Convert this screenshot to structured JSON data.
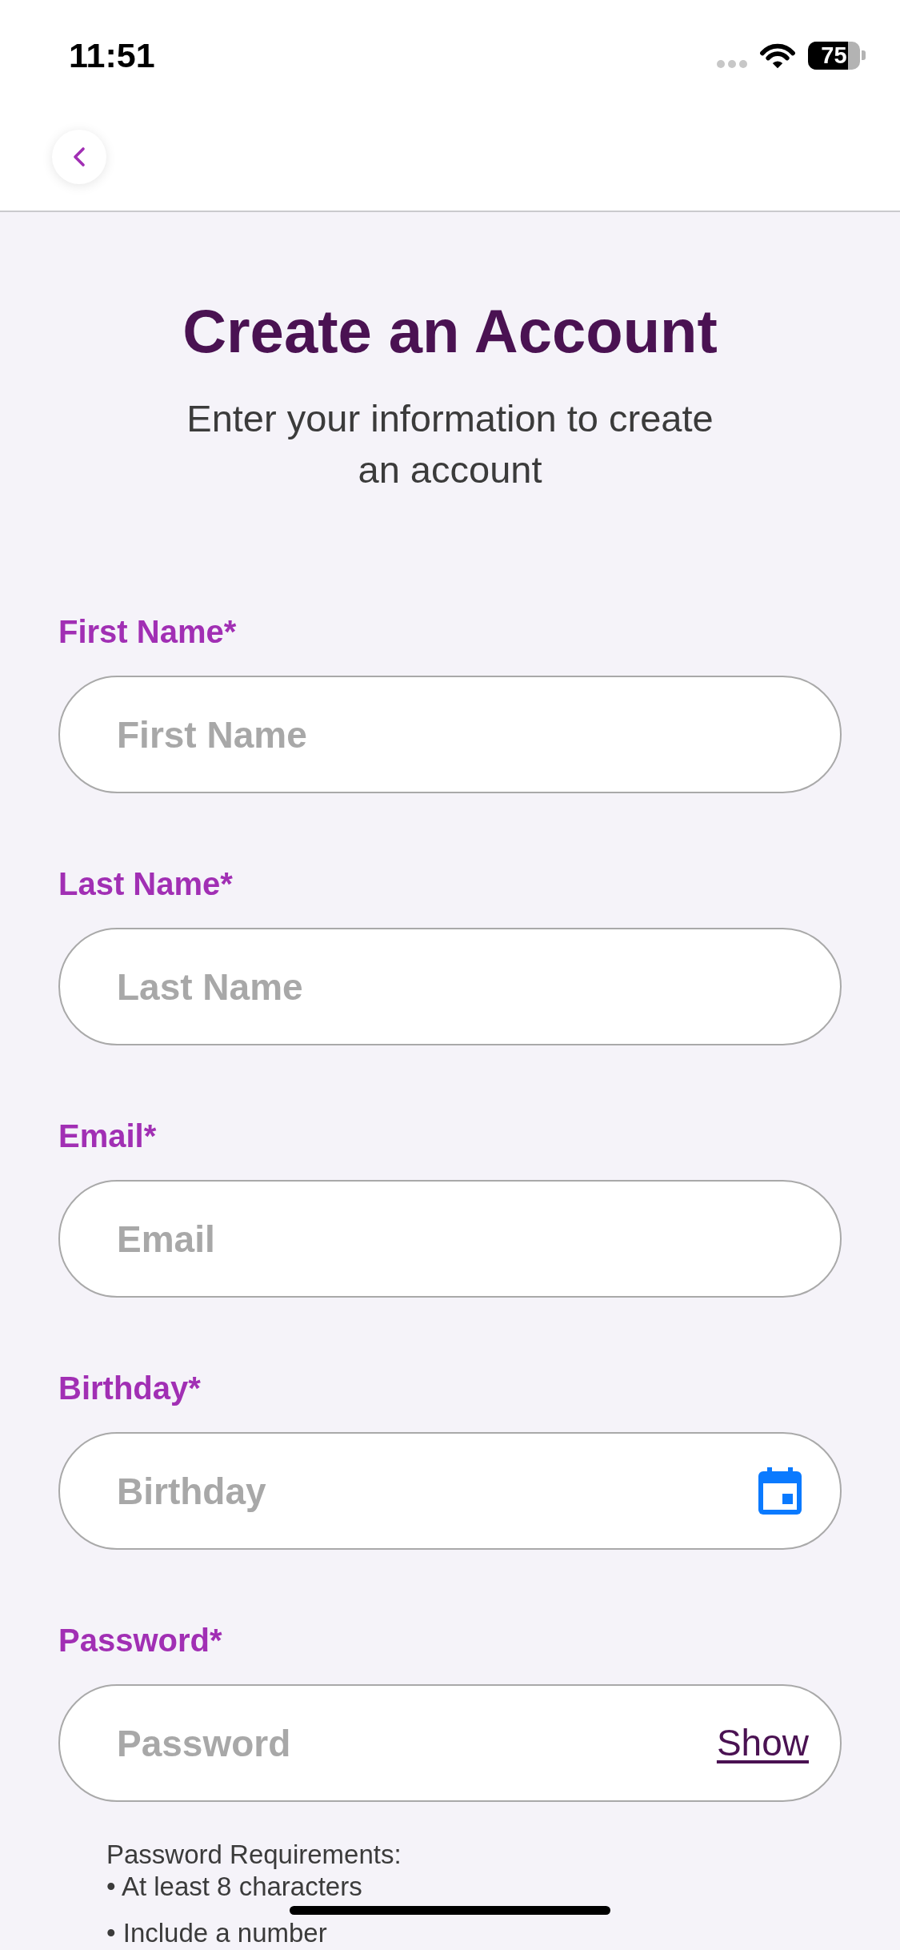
{
  "status_bar": {
    "time": "11:51",
    "battery": "75"
  },
  "title": "Create an Account",
  "subtitle": "Enter your information to create an account",
  "fields": [
    {
      "label": "First Name*",
      "placeholder": "First Name",
      "kind": "text"
    },
    {
      "label": "Last Name*",
      "placeholder": "Last Name",
      "kind": "text"
    },
    {
      "label": "Email*",
      "placeholder": "Email",
      "kind": "text"
    },
    {
      "label": "Birthday*",
      "placeholder": "Birthday",
      "kind": "date"
    },
    {
      "label": "Password*",
      "placeholder": "Password",
      "kind": "password",
      "toggle": "Show"
    }
  ],
  "password_requirements": {
    "title": "Password Requirements:",
    "items": [
      "• At least 8 characters",
      "• Include a number"
    ]
  }
}
